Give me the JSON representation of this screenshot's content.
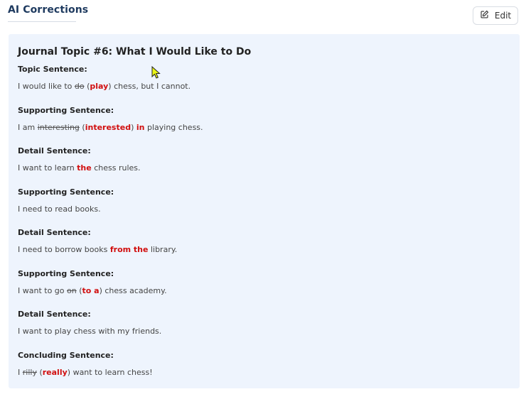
{
  "header": {
    "title": "AI Corrections",
    "edit_label": "Edit"
  },
  "panel": {
    "title": "Journal Topic #6: What I Would Like to Do",
    "sections": [
      {
        "label": "Topic Sentence:",
        "segments": [
          {
            "t": "I would like to "
          },
          {
            "t": "do",
            "k": "del"
          },
          {
            "t": " ("
          },
          {
            "t": "play",
            "k": "ins"
          },
          {
            "t": ") chess, but I cannot."
          }
        ]
      },
      {
        "label": "Supporting Sentence:",
        "segments": [
          {
            "t": "I am "
          },
          {
            "t": "interesting",
            "k": "del"
          },
          {
            "t": " ("
          },
          {
            "t": "interested",
            "k": "ins"
          },
          {
            "t": ") "
          },
          {
            "t": "in",
            "k": "ins"
          },
          {
            "t": " playing chess."
          }
        ]
      },
      {
        "label": "Detail Sentence:",
        "segments": [
          {
            "t": "I want to learn "
          },
          {
            "t": "the",
            "k": "ins"
          },
          {
            "t": " chess rules."
          }
        ]
      },
      {
        "label": "Supporting Sentence:",
        "segments": [
          {
            "t": "I need to read books."
          }
        ]
      },
      {
        "label": "Detail Sentence:",
        "segments": [
          {
            "t": "I need to borrow books "
          },
          {
            "t": "from the",
            "k": "ins"
          },
          {
            "t": " library."
          }
        ]
      },
      {
        "label": "Supporting Sentence:",
        "segments": [
          {
            "t": "I want to go "
          },
          {
            "t": "on",
            "k": "del"
          },
          {
            "t": " ("
          },
          {
            "t": "to a",
            "k": "ins"
          },
          {
            "t": ") chess academy."
          }
        ]
      },
      {
        "label": "Detail Sentence:",
        "segments": [
          {
            "t": "I want to play chess with my friends."
          }
        ]
      },
      {
        "label": "Concluding Sentence:",
        "segments": [
          {
            "t": "I "
          },
          {
            "t": "rilly",
            "k": "del"
          },
          {
            "t": " ("
          },
          {
            "t": "really",
            "k": "ins"
          },
          {
            "t": ") want to learn chess!"
          }
        ]
      }
    ]
  },
  "icons": {
    "edit": "edit-pencil-icon",
    "cursor": "mouse-pointer-icon"
  },
  "colors": {
    "title": "#1e3a5f",
    "panel_bg": "#eef4fd",
    "correction": "#d10f0f"
  }
}
